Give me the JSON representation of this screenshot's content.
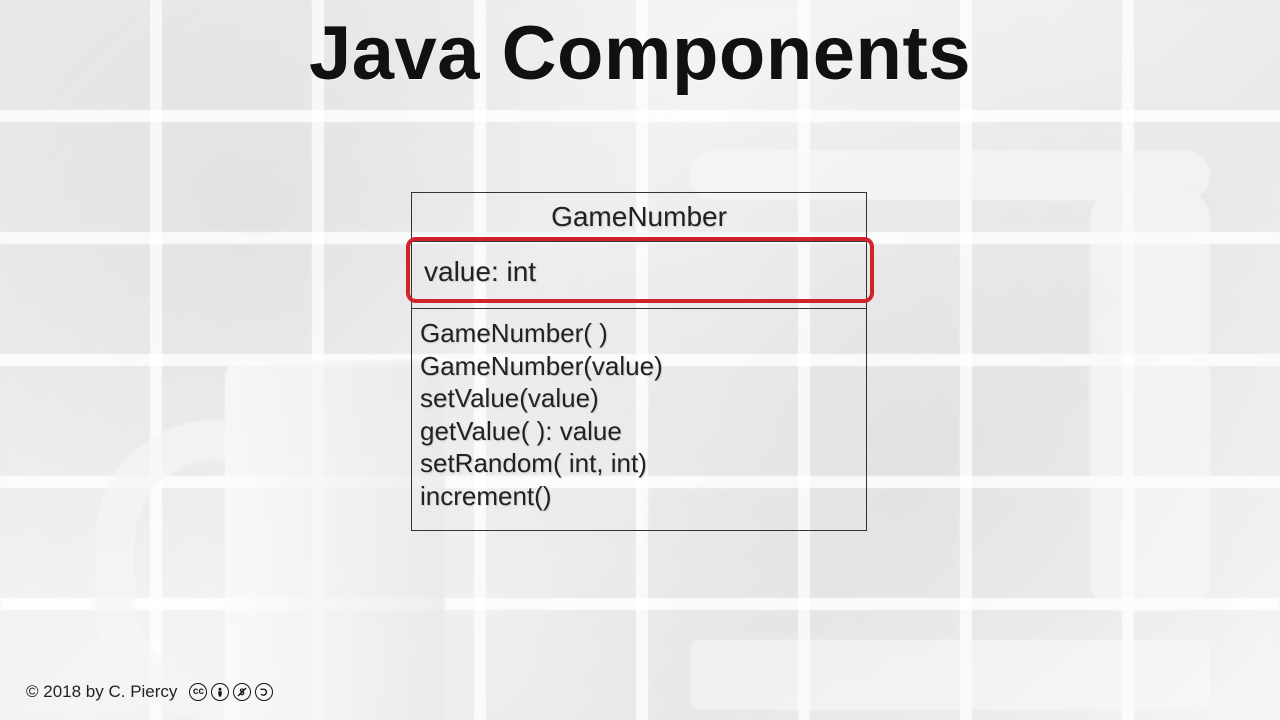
{
  "title": "Java Components",
  "uml": {
    "class_name": "GameNumber",
    "attributes": [
      "value: int"
    ],
    "operations": [
      "GameNumber( )",
      "GameNumber(value)",
      "setValue(value)",
      "getValue( ): value",
      "setRandom( int, int)",
      "increment()"
    ],
    "highlighted_section": "attributes"
  },
  "footer": {
    "copyright": "© 2018 by C. Piercy",
    "license_icons": [
      "cc",
      "by",
      "nc",
      "sa"
    ]
  }
}
